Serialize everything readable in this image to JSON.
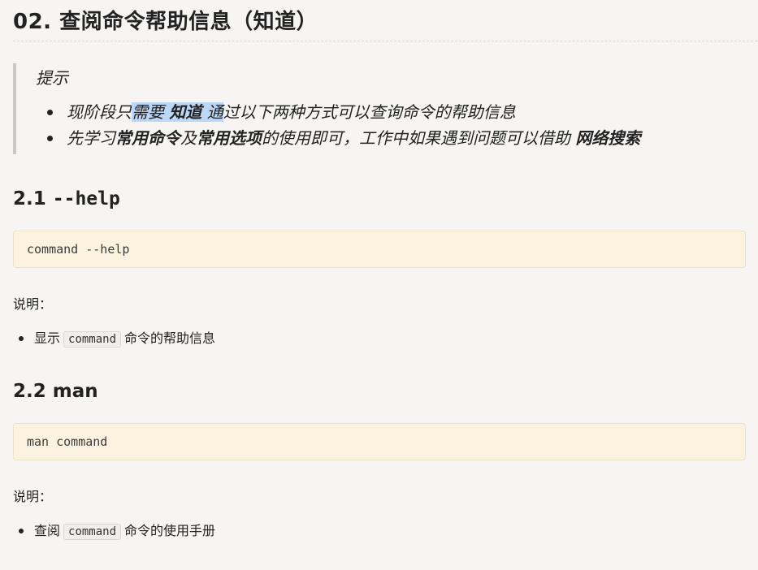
{
  "title": "02. 查阅命令帮助信息（知道）",
  "callout": {
    "title": "提示",
    "item1": {
      "p1": "现阶段只",
      "p2": "需要 ",
      "p3": "知道",
      "p4": " 通",
      "p5": "过以下两种方式可以查询命令的帮助信息"
    },
    "item2": {
      "p1": "先学习",
      "p2": "常用命令",
      "p3": "及",
      "p4": "常用选项",
      "p5": "的使用即可，工作中如果遇到问题可以借助 ",
      "p6": "网络搜索"
    }
  },
  "section1": {
    "number": "2.1 ",
    "name": "--help",
    "code": "command --help",
    "label": "说明：",
    "bullet_pre": "显示",
    "bullet_code": "command",
    "bullet_post": "命令的帮助信息"
  },
  "section2": {
    "number": "2.2 ",
    "name": "man",
    "code": "man command",
    "label": "说明：",
    "bullet_pre": "查阅",
    "bullet_code": "command",
    "bullet_post": "命令的使用手册"
  }
}
